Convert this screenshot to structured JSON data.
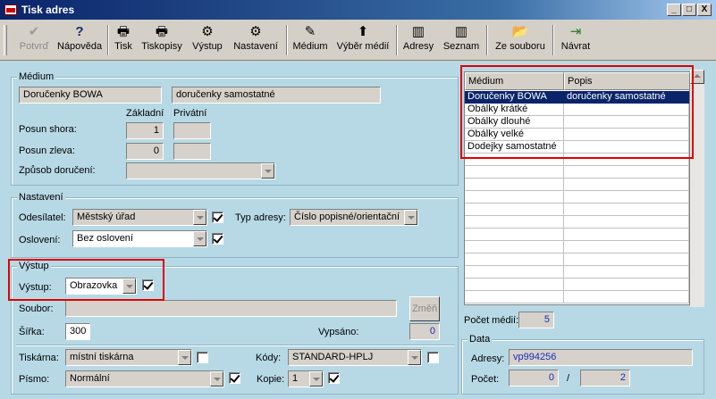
{
  "window": {
    "title": "Tisk adres",
    "minimize": "_",
    "restore": "□",
    "close": "X"
  },
  "toolbar": {
    "items": [
      {
        "label": "Potvrď",
        "icon": "✔"
      },
      {
        "label": "Nápověda",
        "icon": "?"
      },
      {
        "label": "Tisk",
        "icon": "🖶"
      },
      {
        "label": "Tiskopisy",
        "icon": "🖶"
      },
      {
        "label": "Výstup",
        "icon": "⚙"
      },
      {
        "label": "Nastavení",
        "icon": "⚙"
      },
      {
        "label": "Médium",
        "icon": "✎"
      },
      {
        "label": "Výběr médií",
        "icon": "⬆"
      },
      {
        "label": "Adresy",
        "icon": "▥"
      },
      {
        "label": "Seznam",
        "icon": "▥"
      },
      {
        "label": "Ze souboru",
        "icon": "📂"
      },
      {
        "label": "Návrat",
        "icon": "⇥"
      }
    ]
  },
  "medium": {
    "group_label": "Médium",
    "name": "Doručenky BOWA",
    "description": "doručenky samostatné",
    "col_basic": "Základní",
    "col_private": "Privátní",
    "posun_shora_label": "Posun shora:",
    "posun_shora_value": "1",
    "posun_zleva_label": "Posun zleva:",
    "posun_zleva_value": "0",
    "zpusob_label": "Způsob doručení:",
    "zpusob_value": ""
  },
  "nastaveni": {
    "group_label": "Nastavení",
    "odesilatel_label": "Odesílatel:",
    "odesilatel_value": "Městský úřad",
    "typ_adresy_label": "Typ adresy:",
    "typ_adresy_value": "Číslo popisné/orientační",
    "osloveni_label": "Oslovení:",
    "osloveni_value": "Bez oslovení"
  },
  "vystup": {
    "group_label": "Výstup",
    "vystup_label": "Výstup:",
    "vystup_value": "Obrazovka",
    "soubor_label": "Soubor:",
    "soubor_value": "",
    "zmen_button": "Změň",
    "sirka_label": "Šířka:",
    "sirka_value": "300",
    "vypsano_label": "Vypsáno:",
    "vypsano_value": "0",
    "tiskarna_label": "Tiskárna:",
    "tiskarna_value": "místní tiskárna",
    "kody_label": "Kódy:",
    "kody_value": "STANDARD-HPLJ",
    "pismo_label": "Písmo:",
    "pismo_value": "Normální",
    "kopie_label": "Kopie:",
    "kopie_value": "1"
  },
  "media_table": {
    "columns": [
      "Médium",
      "Popis"
    ],
    "rows": [
      [
        "Doručenky BOWA",
        "doručenky samostatné"
      ],
      [
        "Obálky krátké",
        ""
      ],
      [
        "Obálky dlouhé",
        ""
      ],
      [
        "Obálky velké",
        ""
      ],
      [
        "Dodejky samostatné",
        ""
      ]
    ],
    "selected_index": 0
  },
  "summary": {
    "pocet_medii_label": "Počet médií:",
    "pocet_medii_value": "5"
  },
  "data_group": {
    "group_label": "Data",
    "adresy_label": "Adresy:",
    "adresy_value": "vp994256",
    "pocet_label": "Počet:",
    "pocet_value": "0",
    "separator": "/",
    "pocet_total": "2"
  }
}
